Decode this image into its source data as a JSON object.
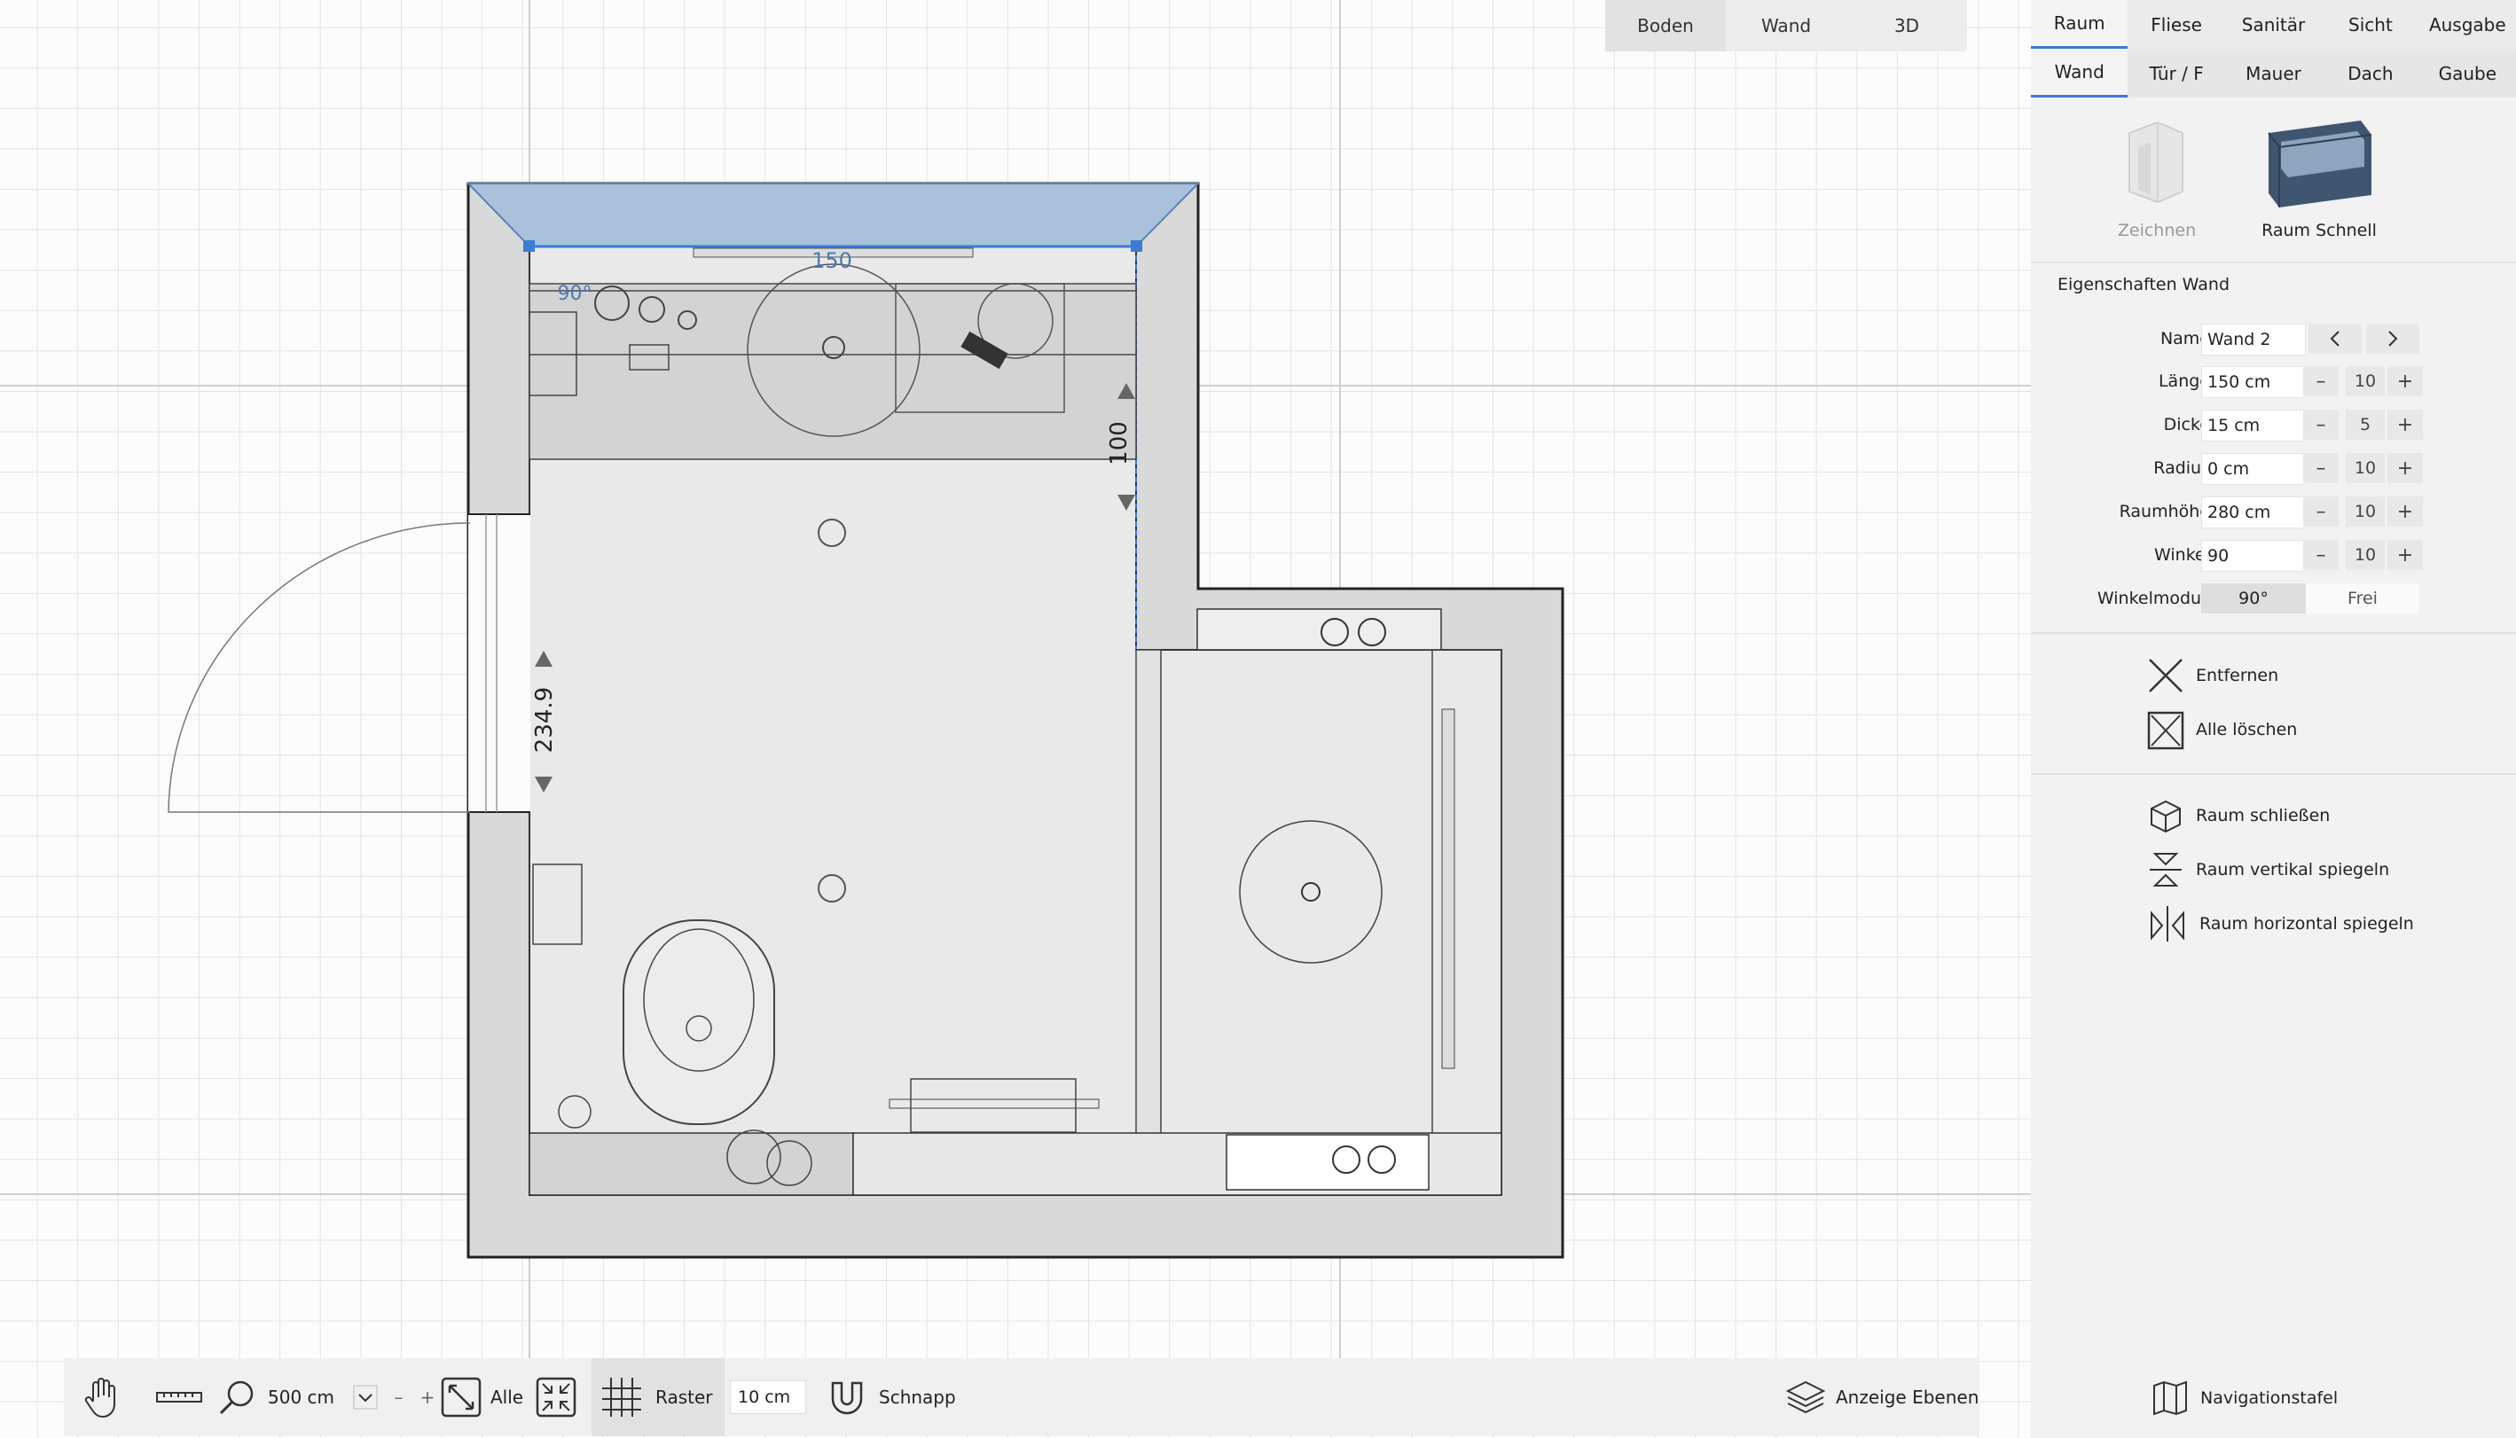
{
  "view_tabs": [
    "Boden",
    "Wand",
    "3D"
  ],
  "view_tab_active": "Boden",
  "plan_labels": {
    "wall_length": "150",
    "angle": "90°",
    "height_right": "100",
    "height_left": "234.9"
  },
  "toolbar": {
    "zoom_value": "500 cm",
    "zoom_minus": "–",
    "zoom_plus": "+",
    "fit_label": "Alle",
    "grid_label": "Raster",
    "grid_value": "10 cm",
    "snap_label": "Schnapp",
    "layers_label": "Anzeige Ebenen"
  },
  "panel": {
    "tabs_row1": [
      "Raum",
      "Fliese",
      "Sanitär",
      "Sicht",
      "Ausgabe"
    ],
    "tabs_row2": [
      "Wand",
      "Tür / F",
      "Mauer",
      "Dach",
      "Gaube"
    ],
    "tool_draw": "Zeichnen",
    "tool_quick": "Raum Schnell",
    "properties_title": "Eigenschaften Wand",
    "props": [
      {
        "label": "Name",
        "value": "Wand 2"
      },
      {
        "label": "Länge",
        "value": "150 cm",
        "step": "10"
      },
      {
        "label": "Dicke",
        "value": "15 cm",
        "step": "5"
      },
      {
        "label": "Radius",
        "value": "0 cm",
        "step": "10"
      },
      {
        "label": "Raumhöhe",
        "value": "280 cm",
        "step": "10"
      },
      {
        "label": "Winkel",
        "value": "90",
        "step": "10"
      }
    ],
    "angle_mode_label": "Winkelmodus",
    "angle_mode_options": [
      "90°",
      "Frei"
    ],
    "action_remove": "Entfernen",
    "action_delete_all": "Alle löschen",
    "action_close_room": "Raum schließen",
    "action_mirror_v": "Raum vertikal spiegeln",
    "action_mirror_h": "Raum horizontal spiegeln",
    "nav_panel": "Navigationstafel"
  },
  "colors": {
    "accent": "#3a7bd5",
    "wall_fill": "#d9d9d9",
    "floor_fill": "#e9e9e9",
    "selection": "#9fb9d6"
  }
}
